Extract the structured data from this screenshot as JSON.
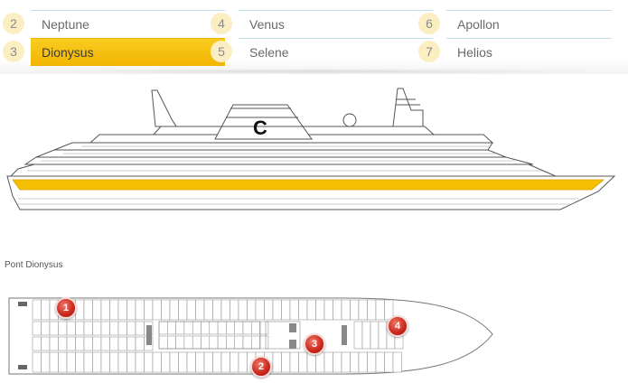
{
  "decks": [
    {
      "num": "2",
      "label": "Neptune"
    },
    {
      "num": "3",
      "label": "Dionysus",
      "active": true
    },
    {
      "num": "4",
      "label": "Venus"
    },
    {
      "num": "5",
      "label": "Selene"
    },
    {
      "num": "6",
      "label": "Apollon"
    },
    {
      "num": "7",
      "label": "Helios"
    }
  ],
  "ship": {
    "logo_letter": "C",
    "highlight_color": "#f6be00"
  },
  "plan": {
    "title": "Pont Dionysus",
    "markers": [
      "1",
      "2",
      "3",
      "4"
    ],
    "cabin_prefix": "3"
  }
}
